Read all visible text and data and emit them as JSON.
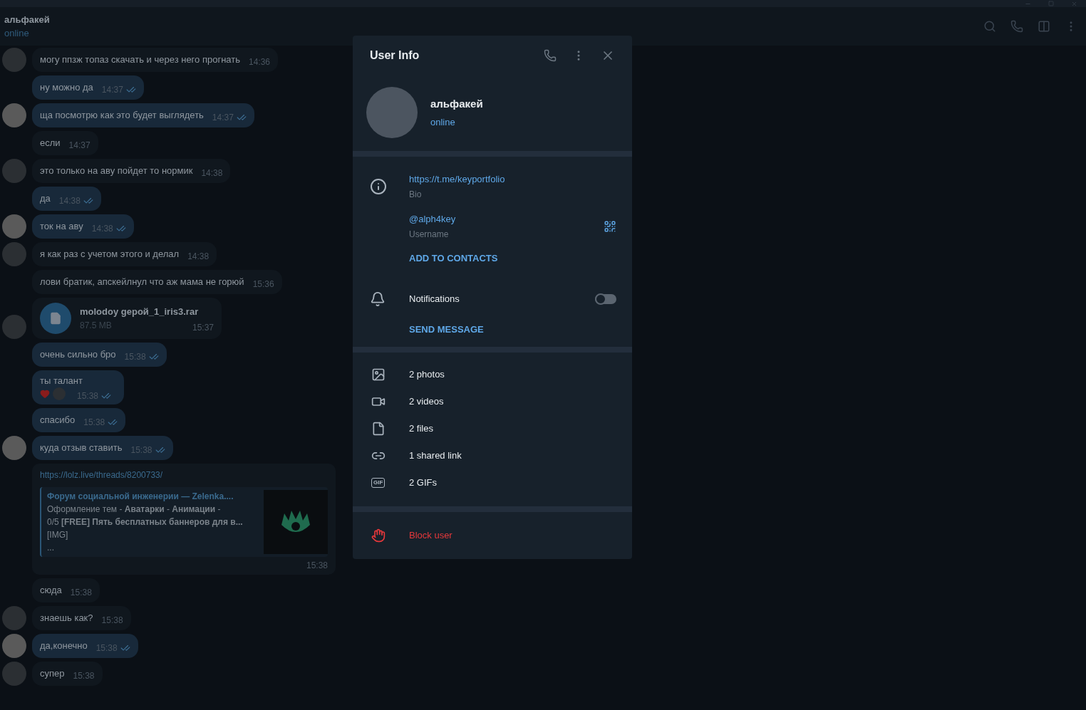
{
  "chat": {
    "name": "альфакей",
    "status": "online"
  },
  "messages": [
    {
      "kind": "text",
      "outgoing": false,
      "text": "могу ппзж топаз скачать и через него прогнать",
      "time": "14:36",
      "avatar": true
    },
    {
      "kind": "text",
      "outgoing": true,
      "text": "ну можно да",
      "time": "14:37",
      "avatar": false,
      "read": true
    },
    {
      "kind": "text",
      "outgoing": true,
      "text": "ща посмотрю как это будет выглядеть",
      "time": "14:37",
      "avatar": true,
      "read": true
    },
    {
      "kind": "text",
      "outgoing": false,
      "text": "если",
      "time": "14:37",
      "avatar": false
    },
    {
      "kind": "text",
      "outgoing": false,
      "text": "это только на аву пойдет то нормик",
      "time": "14:38",
      "avatar": true
    },
    {
      "kind": "text",
      "outgoing": true,
      "text": "да",
      "time": "14:38",
      "avatar": false,
      "read": true
    },
    {
      "kind": "text",
      "outgoing": true,
      "text": "ток на аву",
      "time": "14:38",
      "avatar": true,
      "read": true
    },
    {
      "kind": "text",
      "outgoing": false,
      "text": "я как раз с учетом этого и делал",
      "time": "14:38",
      "avatar": true
    },
    {
      "kind": "text",
      "outgoing": false,
      "text": "лови братик, апскейлнул что аж мама не горюй",
      "time": "15:36",
      "avatar": false
    },
    {
      "kind": "file",
      "outgoing": false,
      "name": "molodoy gepой_1_iris3.rar",
      "size": "87.5 MB",
      "time": "15:37",
      "avatar": true
    },
    {
      "kind": "text",
      "outgoing": true,
      "text": "очень сильно бро",
      "time": "15:38",
      "avatar": false,
      "read": true
    },
    {
      "kind": "reaction",
      "outgoing": true,
      "text": "ты талант",
      "time": "15:38",
      "avatar": false,
      "read": true
    },
    {
      "kind": "text",
      "outgoing": true,
      "text": "спасибо",
      "time": "15:38",
      "avatar": false,
      "read": true
    },
    {
      "kind": "text",
      "outgoing": true,
      "text": "куда отзыв ставить",
      "time": "15:38",
      "avatar": true,
      "read": true
    },
    {
      "kind": "link",
      "outgoing": false,
      "url": "https://lolz.live/threads/8200733/",
      "preview_title": "Форум социальной инженерии —  Zelenka....",
      "preview_lines": [
        "Оформление тем - **Аватарки** - **Анимации** -",
        "0/5 **[FREE] Пять бесплатных баннеров для в...**",
        "[IMG]",
        "..."
      ],
      "time": "15:38",
      "avatar": false
    },
    {
      "kind": "text",
      "outgoing": false,
      "text": "сюда",
      "time": "15:38",
      "avatar": false
    },
    {
      "kind": "text",
      "outgoing": false,
      "text": "знаешь как?",
      "time": "15:38",
      "avatar": true
    },
    {
      "kind": "text",
      "outgoing": true,
      "text": "да,конечно",
      "time": "15:38",
      "avatar": true,
      "read": true
    },
    {
      "kind": "text",
      "outgoing": false,
      "text": "супер",
      "time": "15:38",
      "avatar": true
    }
  ],
  "user_info": {
    "title": "User Info",
    "name": "альфакей",
    "status": "online",
    "info_rows": [
      {
        "kind": "bio",
        "value": "https://t.me/keyportfolio",
        "label": "Bio"
      },
      {
        "kind": "username",
        "value": "@alph4key",
        "label": "Username"
      }
    ],
    "add_contact": "ADD TO CONTACTS",
    "notifications": {
      "label": "Notifications",
      "on": false
    },
    "send_message": "SEND MESSAGE",
    "media": [
      {
        "kind": "photos",
        "label": "2 photos"
      },
      {
        "kind": "videos",
        "label": "2 videos"
      },
      {
        "kind": "files",
        "label": "2 files"
      },
      {
        "kind": "links",
        "label": "1 shared link"
      },
      {
        "kind": "gifs",
        "label": "2 GIFs",
        "icon_text": "GIF"
      }
    ],
    "block": "Block user"
  }
}
